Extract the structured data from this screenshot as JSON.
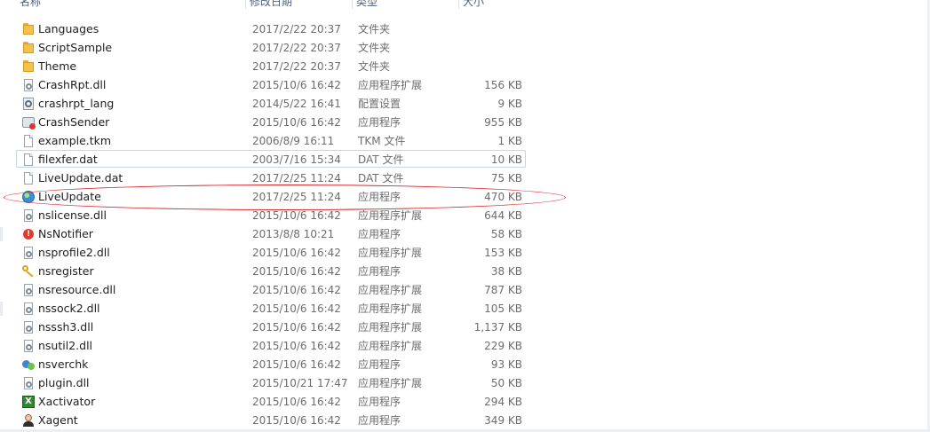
{
  "columns": {
    "name": "名称",
    "date": "修改日期",
    "type": "类型",
    "size": "大小"
  },
  "files": [
    {
      "name": "Languages",
      "date": "2017/2/22 20:37",
      "type": "文件夹",
      "size": "",
      "icon": "folder-icon"
    },
    {
      "name": "ScriptSample",
      "date": "2017/2/22 20:37",
      "type": "文件夹",
      "size": "",
      "icon": "folder-icon"
    },
    {
      "name": "Theme",
      "date": "2017/2/22 20:37",
      "type": "文件夹",
      "size": "",
      "icon": "folder-icon"
    },
    {
      "name": "CrashRpt.dll",
      "date": "2015/10/6 16:42",
      "type": "应用程序扩展",
      "size": "156 KB",
      "icon": "dll-icon"
    },
    {
      "name": "crashrpt_lang",
      "date": "2014/5/22 16:41",
      "type": "配置设置",
      "size": "9 KB",
      "icon": "config-icon"
    },
    {
      "name": "CrashSender",
      "date": "2015/10/6 16:42",
      "type": "应用程序",
      "size": "955 KB",
      "icon": "crash-app-icon"
    },
    {
      "name": "example.tkm",
      "date": "2006/8/9 16:11",
      "type": "TKM 文件",
      "size": "1 KB",
      "icon": "file-icon"
    },
    {
      "name": "filexfer.dat",
      "date": "2003/7/16 15:34",
      "type": "DAT 文件",
      "size": "10 KB",
      "icon": "file-icon",
      "focused": true
    },
    {
      "name": "LiveUpdate.dat",
      "date": "2017/2/25 11:24",
      "type": "DAT 文件",
      "size": "75 KB",
      "icon": "file-icon"
    },
    {
      "name": "LiveUpdate",
      "date": "2017/2/25 11:24",
      "type": "应用程序",
      "size": "470 KB",
      "icon": "globe-icon"
    },
    {
      "name": "nslicense.dll",
      "date": "2015/10/6 16:42",
      "type": "应用程序扩展",
      "size": "644 KB",
      "icon": "dll-icon"
    },
    {
      "name": "NsNotifier",
      "date": "2013/8/8 10:21",
      "type": "应用程序",
      "size": "58 KB",
      "icon": "alert-icon"
    },
    {
      "name": "nsprofile2.dll",
      "date": "2015/10/6 16:42",
      "type": "应用程序扩展",
      "size": "153 KB",
      "icon": "dll-icon"
    },
    {
      "name": "nsregister",
      "date": "2015/10/6 16:42",
      "type": "应用程序",
      "size": "38 KB",
      "icon": "key-icon"
    },
    {
      "name": "nsresource.dll",
      "date": "2015/10/6 16:42",
      "type": "应用程序扩展",
      "size": "787 KB",
      "icon": "dll-icon"
    },
    {
      "name": "nssock2.dll",
      "date": "2015/10/6 16:42",
      "type": "应用程序扩展",
      "size": "105 KB",
      "icon": "dll-icon"
    },
    {
      "name": "nsssh3.dll",
      "date": "2015/10/6 16:42",
      "type": "应用程序扩展",
      "size": "1,137 KB",
      "icon": "dll-icon"
    },
    {
      "name": "nsutil2.dll",
      "date": "2015/10/6 16:42",
      "type": "应用程序扩展",
      "size": "229 KB",
      "icon": "dll-icon"
    },
    {
      "name": "nsverchk",
      "date": "2015/10/6 16:42",
      "type": "应用程序",
      "size": "93 KB",
      "icon": "network-icon"
    },
    {
      "name": "plugin.dll",
      "date": "2015/10/21 17:47",
      "type": "应用程序扩展",
      "size": "50 KB",
      "icon": "dll-icon"
    },
    {
      "name": "Xactivator",
      "date": "2015/10/6 16:42",
      "type": "应用程序",
      "size": "294 KB",
      "icon": "x-app-icon"
    },
    {
      "name": "Xagent",
      "date": "2015/10/6 16:42",
      "type": "应用程序",
      "size": "349 KB",
      "icon": "agent-icon"
    }
  ],
  "colors": {
    "annotation": "#d8282c",
    "focus_border": "#c3d6ec"
  }
}
